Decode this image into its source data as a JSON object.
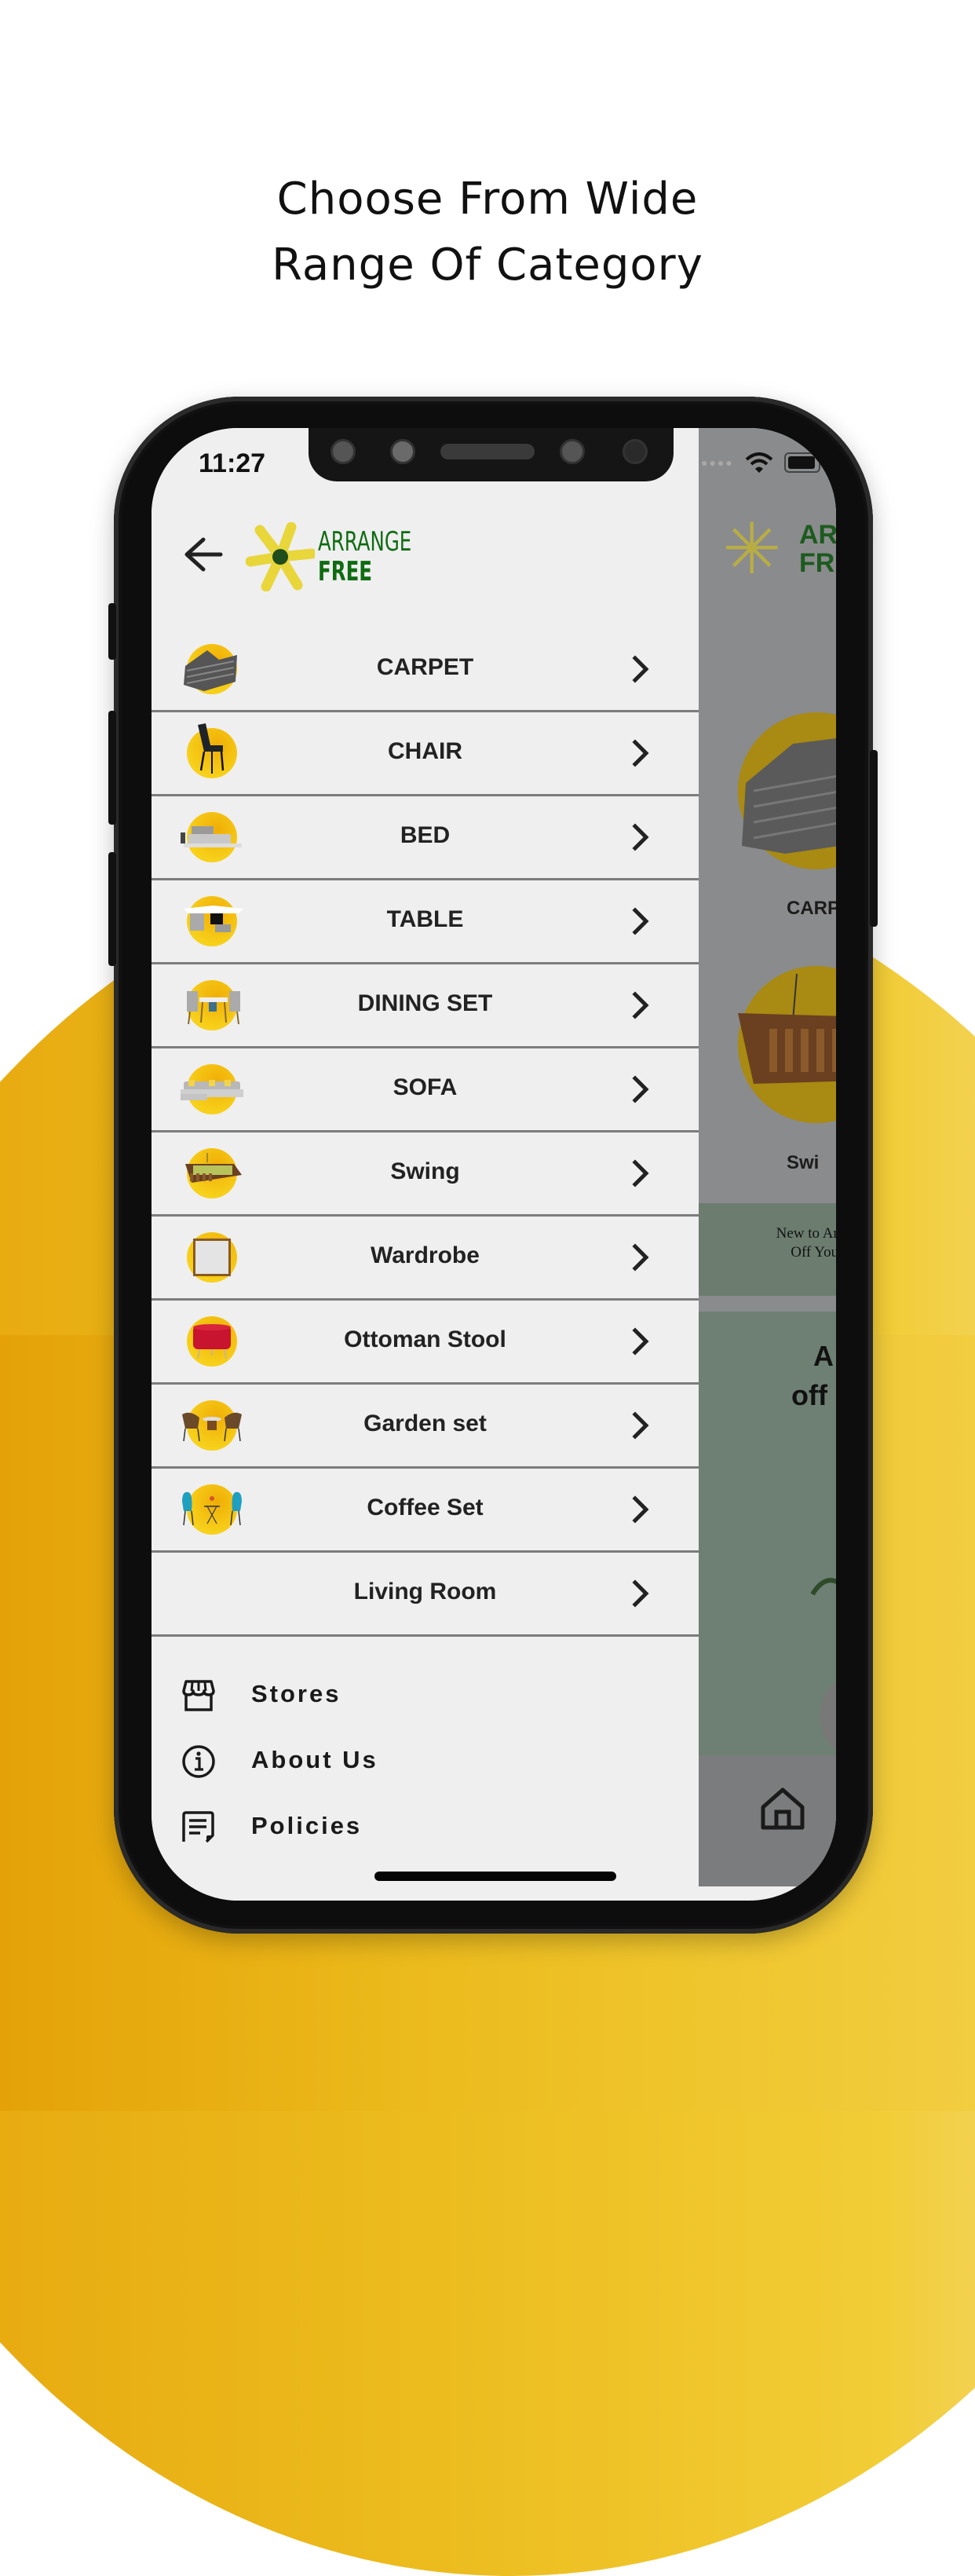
{
  "headline": {
    "line1": "Choose From Wide",
    "line2": "Range Of Category"
  },
  "status_bar": {
    "time": "11:27",
    "wifi_icon": "wifi-icon",
    "battery_icon": "battery-icon"
  },
  "header": {
    "back_icon": "arrow-left-icon",
    "brand_line1": "ARRANGE",
    "brand_line2": "FREE"
  },
  "colors": {
    "accent_yellow": "#f5c518",
    "brand_green": "#0f6b12",
    "drawer_bg": "#efefef",
    "divider": "#7c7c7c"
  },
  "categories": [
    {
      "label": "CARPET",
      "image": "carpet"
    },
    {
      "label": "CHAIR",
      "image": "chair"
    },
    {
      "label": "BED",
      "image": "bed"
    },
    {
      "label": "TABLE",
      "image": "table"
    },
    {
      "label": "DINING SET",
      "image": "dining-set"
    },
    {
      "label": "SOFA",
      "image": "sofa"
    },
    {
      "label": "Swing",
      "image": "swing"
    },
    {
      "label": "Wardrobe",
      "image": "wardrobe"
    },
    {
      "label": "Ottoman Stool",
      "image": "ottoman-stool"
    },
    {
      "label": "Garden set",
      "image": "garden-set"
    },
    {
      "label": "Coffee Set",
      "image": "coffee-set"
    },
    {
      "label": "Living Room",
      "image": ""
    }
  ],
  "links": [
    {
      "label": "Stores",
      "icon": "store-icon"
    },
    {
      "label": "About Us",
      "icon": "info-icon"
    },
    {
      "label": "Policies",
      "icon": "document-icon"
    }
  ],
  "background_screen": {
    "brand_partial_line1": "ARI",
    "brand_partial_line2": "FRI",
    "category_1_partial": "CARP",
    "category_2_partial": "Swi",
    "promo_line1": "New to Arrange fr",
    "promo_line2": "Off Your Firs",
    "banner_line1": "A",
    "banner_line2": "off",
    "tab_icon": "home-icon"
  }
}
